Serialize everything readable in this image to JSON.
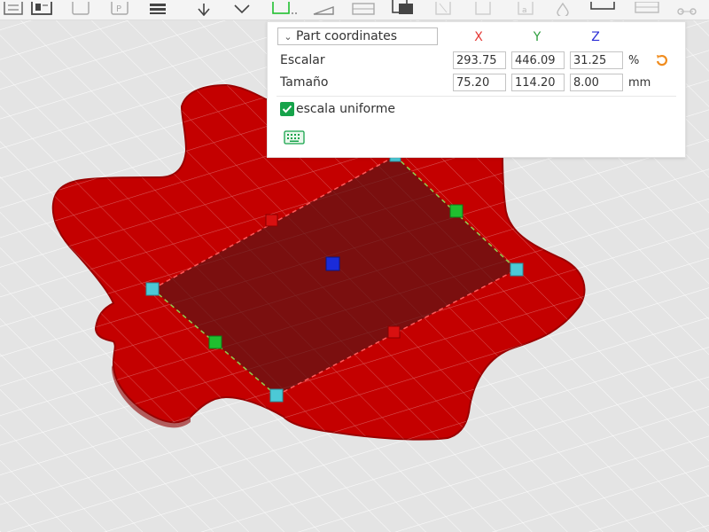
{
  "colors": {
    "model_red": "#c40000",
    "model_outline": "#9a0000",
    "selection_fill": "#5e1515",
    "axis_x": "#e53935",
    "axis_y": "#2e9e3e",
    "axis_z": "#2c2fd6",
    "handle_cyan": "#4cc9d6",
    "handle_green": "#1fbf2f",
    "handle_red": "#d81010",
    "handle_blue": "#1a2bd9",
    "accent_orange": "#f08c1e",
    "check_green": "#16a34a"
  },
  "toolbar": {
    "icons": [
      "object-list-icon",
      "layout-icon",
      "cut-icon",
      "placeholder-icon",
      "layers-icon",
      "move-icon",
      "rotate-icon",
      "scale-icon",
      "slope-icon",
      "plane-icon",
      "split-icon",
      "support-paint-icon",
      "seam-icon",
      "measure-icon",
      "text-icon",
      "color-paint-icon",
      "assembly-icon",
      "camera-icon"
    ]
  },
  "scale_panel": {
    "coord_system": "Part coordinates",
    "axes": [
      "X",
      "Y",
      "Z"
    ],
    "scale": {
      "label": "Escalar",
      "x": "293.75",
      "y": "446.09",
      "z": "31.25",
      "unit": "%"
    },
    "size": {
      "label": "Tamaño",
      "x": "75.20",
      "y": "114.20",
      "z": "8.00",
      "unit": "mm"
    },
    "uniform": {
      "label": "escala uniforme",
      "checked": true
    },
    "reset_icon": "reset-arrow-icon",
    "keyboard_icon": "keyboard-icon"
  }
}
